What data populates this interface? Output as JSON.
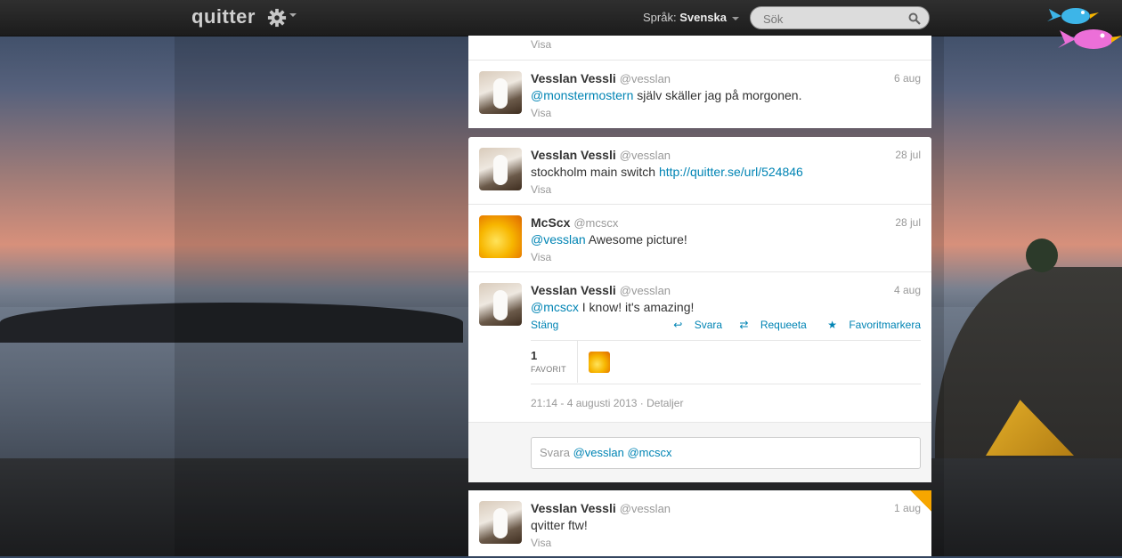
{
  "topbar": {
    "logo": "quitter",
    "language_label": "Språk:",
    "language_value": "Svenska",
    "search_placeholder": "Sök"
  },
  "tweets_top": {
    "partial_visa": "Visa",
    "tweet1": {
      "name": "Vesslan Vessli",
      "handle": "@vesslan",
      "date": "6 aug",
      "mention": "@monstermostern",
      "text": " själv skäller jag på morgonen.",
      "visa": "Visa"
    }
  },
  "conversation": {
    "t1": {
      "name": "Vesslan Vessli",
      "handle": "@vesslan",
      "date": "28 jul",
      "text": "stockholm main switch ",
      "link": "http://quitter.se/url/524846",
      "visa": "Visa"
    },
    "t2": {
      "name": "McScx",
      "handle": "@mcscx",
      "date": "28 jul",
      "mention": "@vesslan",
      "text": " Awesome picture!",
      "visa": "Visa"
    },
    "t3": {
      "name": "Vesslan Vessli",
      "handle": "@vesslan",
      "date": "4 aug",
      "mention": "@mcscx",
      "text": " I know! it's amazing!",
      "close": "Stäng",
      "reply": "Svara",
      "requeet": "Requeeta",
      "favorite": "Favoritmarkera",
      "fav_count": "1",
      "fav_label": "FAVORIT",
      "timestamp": "21:14 - 4 augusti 2013",
      "details": "Detaljer"
    },
    "reply_prefix": "Svara ",
    "reply_mentions": "@vesslan @mcscx"
  },
  "tweet_bottom": {
    "name": "Vesslan Vessli",
    "handle": "@vesslan",
    "date": "1 aug",
    "text": "qvitter ftw!",
    "visa": "Visa"
  }
}
